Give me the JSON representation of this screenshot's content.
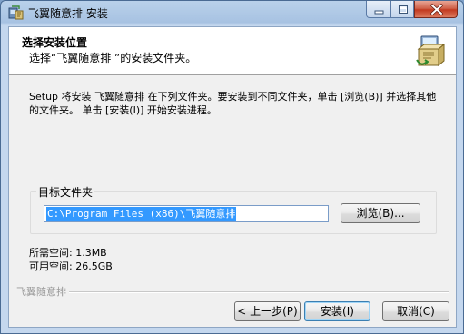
{
  "window": {
    "title": "飞翼随意排 安装",
    "icon": "installer-icon"
  },
  "header": {
    "title": "选择安装位置",
    "subtitle": "选择“飞翼随意排 ”的安装文件夹。",
    "logo_icon": "installer-package-icon"
  },
  "instruction": "Setup 将安装 飞翼随意排 在下列文件夹。要安装到不同文件夹，单击 [浏览(B)] 并选择其他的文件夹。 单击 [安装(I)] 开始安装进程。",
  "destination": {
    "label": "目标文件夹",
    "path": "C:\\Program Files (x86)\\飞翼随意排",
    "browse_label": "浏览(B)..."
  },
  "space": {
    "required": "所需空间: 1.3MB",
    "available": "可用空间: 26.5GB"
  },
  "footer": {
    "brand": "飞翼随意排",
    "back_label": "< 上一步(P)",
    "install_label": "安装(I)",
    "cancel_label": "取消(C)"
  },
  "colors": {
    "selection": "#3399ff",
    "title_bar": "#b9d1ea",
    "close_button": "#c2391f"
  }
}
